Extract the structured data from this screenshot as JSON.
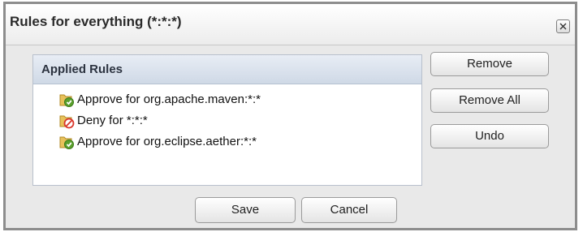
{
  "dialog": {
    "title": "Rules for everything (*:*:*)",
    "close_icon": "close-icon"
  },
  "panel": {
    "header": "Applied Rules",
    "rules": [
      {
        "label": "Approve for org.apache.maven:*:*",
        "icon": "approve-icon",
        "color": "#5aa02c"
      },
      {
        "label": "Deny for *:*:*",
        "icon": "deny-icon",
        "color": "#d9362b"
      },
      {
        "label": "Approve for org.eclipse.aether:*:*",
        "icon": "approve-icon",
        "color": "#5aa02c"
      }
    ]
  },
  "actions": {
    "remove_label": "Remove",
    "remove_all_label": "Remove All",
    "undo_label": "Undo"
  },
  "footer": {
    "save_label": "Save",
    "cancel_label": "Cancel"
  }
}
